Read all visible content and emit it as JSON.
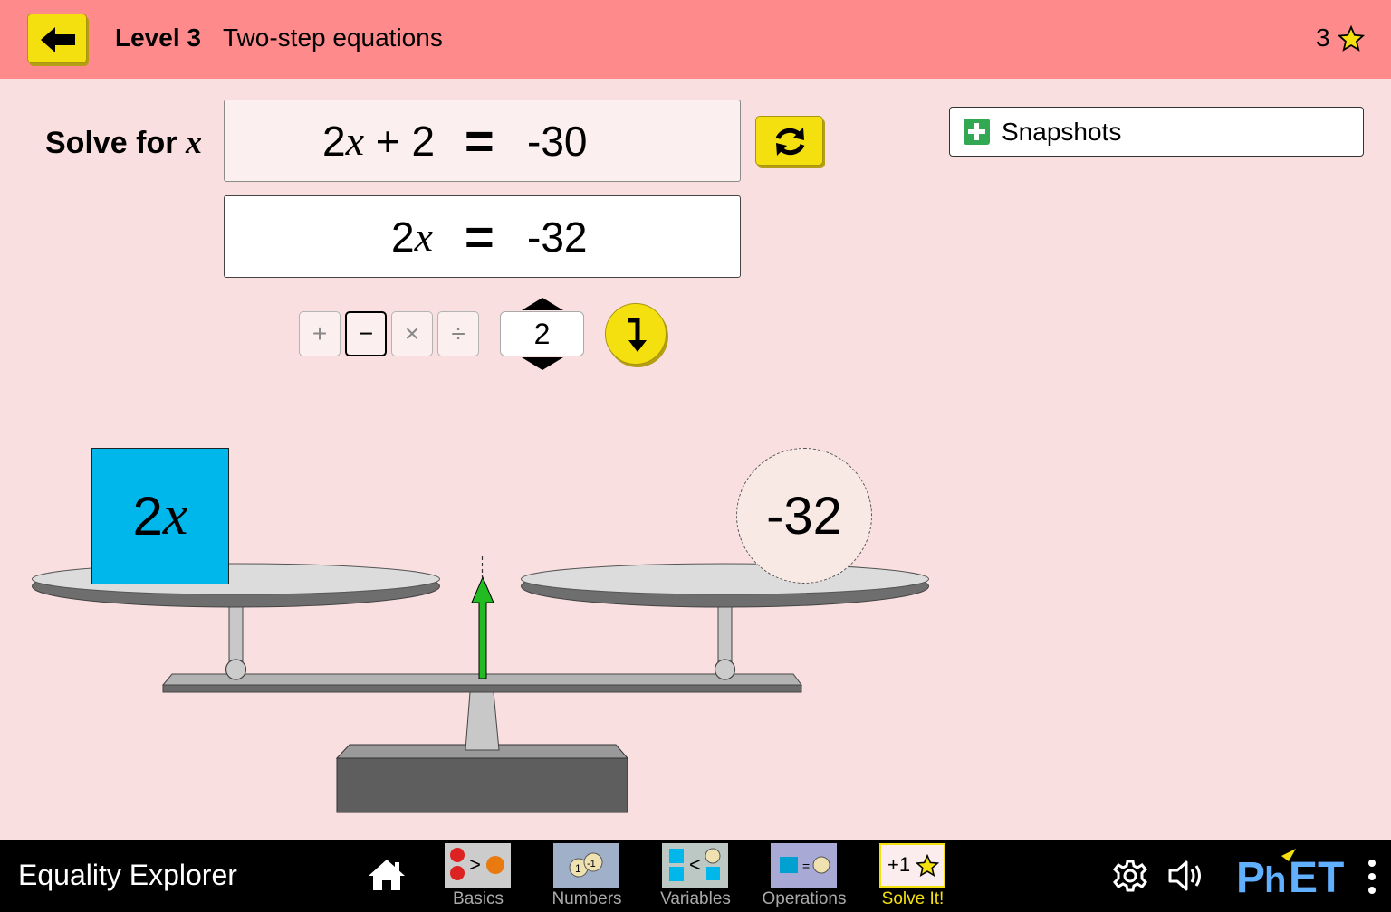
{
  "header": {
    "level_label": "Level 3",
    "level_description": "Two-step equations",
    "score": "3",
    "back_icon": "arrow-left-icon",
    "star_icon": "star-icon",
    "color": "#ff8a8c"
  },
  "solve": {
    "label": "Solve for",
    "variable": "x"
  },
  "equations": [
    {
      "coef": "2",
      "var": "x",
      "rest": " + 2",
      "sign": "=",
      "rhs": "-30"
    },
    {
      "coef": "2",
      "var": "x",
      "rest": "",
      "sign": "=",
      "rhs": "-32"
    }
  ],
  "refresh_icon": "refresh-icon",
  "snapshots": {
    "label": "Snapshots",
    "icon": "plus-icon"
  },
  "operation": {
    "operators": [
      "+",
      "−",
      "×",
      "÷"
    ],
    "selected": "−",
    "operand": "2",
    "apply_icon": "apply-down-arrow-icon"
  },
  "scale": {
    "left_item": {
      "coef": "2",
      "var": "x",
      "color": "#00b7eb"
    },
    "right_item": {
      "value": "-32"
    }
  },
  "navbar": {
    "app_title": "Equality Explorer",
    "home_icon": "home-icon",
    "screens": [
      {
        "label": "Basics",
        "selected": false
      },
      {
        "label": "Numbers",
        "selected": false
      },
      {
        "label": "Variables",
        "selected": false
      },
      {
        "label": "Operations",
        "selected": false
      },
      {
        "label": "Solve It!",
        "selected": true,
        "icon_text": "+1"
      }
    ],
    "settings_icon": "gear-icon",
    "sound_icon": "speaker-icon",
    "logo": "PhET",
    "menu_icon": "kebab-menu-icon"
  },
  "colors": {
    "background": "#fadfe0",
    "button_yellow": "#f5e00f",
    "arrow_green": "#22bb22"
  }
}
